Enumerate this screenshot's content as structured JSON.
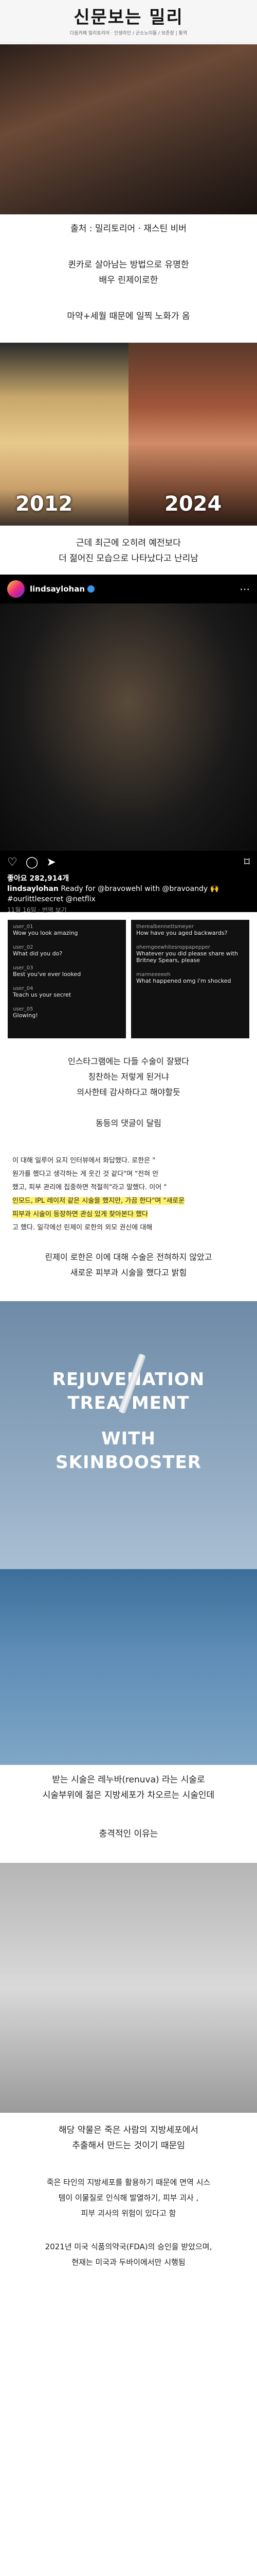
{
  "header": {
    "logo": "신문보는 밀리",
    "subtitle": "다음카페 밀리토리어 · 인생라인 / 군소노이들 / 보존장 | 통역"
  },
  "captions": {
    "source": "출처 : 밀리토리어 · 재스틴 비버",
    "line1": "퀸카로 살아남는 방법으로 유명한",
    "line2": "배우 린제이로한",
    "line3": "마약+세월 때문에 일찍 노화가 옴",
    "line4": "근데 최근에 오히려 예전보다",
    "line5": "더 젊어진 모습으로 나타났다고 난리남"
  },
  "years": {
    "left": "2012",
    "right": "2024"
  },
  "instagram": {
    "username": "lindsaylohan",
    "likes": "좋아요 282,914개",
    "caption_user": "lindsaylohan",
    "caption_text": "Ready for @bravowehl with @bravoandy 🙌 #ourlittlesecret @netflix",
    "date": "11월 16일 · 번역 보기"
  },
  "comments_left": [
    {
      "user": "user_01",
      "msg": "Wow you look amazing"
    },
    {
      "user": "user_02",
      "msg": "What did you do?"
    },
    {
      "user": "user_03",
      "msg": "Best you've ever looked"
    },
    {
      "user": "user_04",
      "msg": "Teach us your secret"
    },
    {
      "user": "user_05",
      "msg": "Glowing!"
    }
  ],
  "comments_right": [
    {
      "user": "therealbennettsmeyer",
      "msg": "How have you aged backwards?"
    },
    {
      "user": "ohemgeewhitesroppapepper",
      "msg": "Whatever you did please share with Britney Spears, please"
    },
    {
      "user": "marmeeeeeh",
      "msg": "What happened omg i'm shocked"
    }
  ],
  "paragraphs": {
    "p1a": "인스타그램에는 다들 수술이 잘됐다",
    "p1b": "칭찬하는 저렇게 된거냐",
    "p1c": "의사한테 감사하다고 해야할듯",
    "p2": "동등의 댓글이 달림",
    "p3a": "이 대해 일루어 요지 인터뷰에서 화답했다. 로한은 \"",
    "p3b": "원가를 했다고 생각하는 게 웃긴 것 같다\"며 \"전혀 안",
    "p3c": "했고, 피부 관리에 집중하면 적절히\"라고 말했다. 이어 \"",
    "p3d": "인모드, IPL 레이저 같은 시술을 했지만, 가끔 한다\"며 \"새로운",
    "p3e": "피부과 시술이 등장하면 관심 있게 찾아본다 했다",
    "p3f": "고 했다. 일각에선 린제이 로한의 외모 권신에 대해",
    "p4a": "린제이 로한은 이에 대해 수술은 전혀하지 않았고",
    "p4b": "새로운 피부과 시술을 했다고 밝힘",
    "p5a": "받는 시술은 레누바(renuva) 라는 시술로",
    "p5b": "시술부위에 젊은 지방세포가 차오르는 시술인데",
    "p6": "충격적인 이유는",
    "p7a": "해당 약물은 죽은 사람의 지방세포에서",
    "p7b": "추출해서 만드는 것이기 때문임",
    "p8a": "죽은 타인의 지방세포를 활용하기 때문에 면역 시스",
    "p8b": "템이 이물질로 인식해 발열하기, 피부 괴사 ,",
    "p8c": "피부 괴사의 위험이 있다고 함",
    "p9a": "2021년 미국 식품의약국(FDA)의 승인을 받았으며,",
    "p9b": "현재는 미국과 두바이에서만 시행됨"
  },
  "overlay": {
    "line1": "REJUVENATION",
    "line2": "TREATMENT",
    "line3": "WITH",
    "line4": "SKINBOOSTER"
  }
}
